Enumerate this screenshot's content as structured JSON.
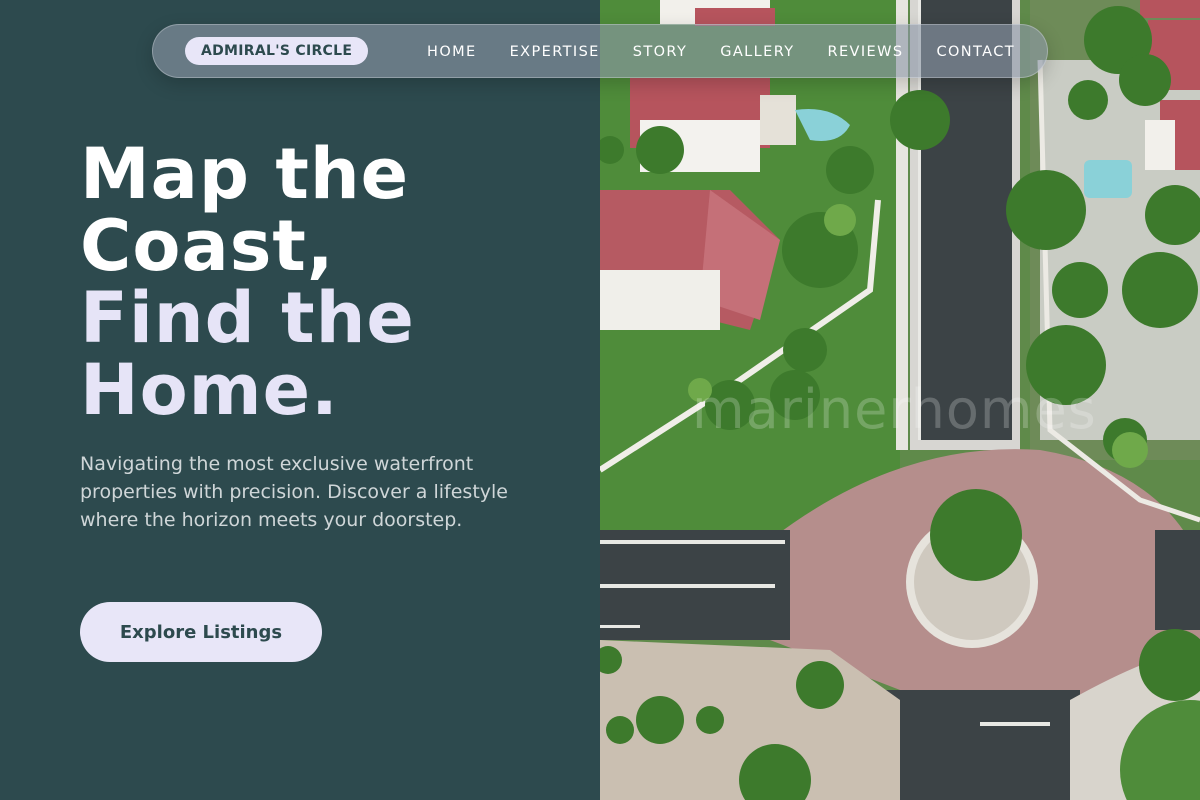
{
  "brand": {
    "name": "ADMIRAL'S CIRCLE"
  },
  "nav": {
    "items": [
      {
        "label": "HOME"
      },
      {
        "label": "EXPERTISE"
      },
      {
        "label": "STORY"
      },
      {
        "label": "GALLERY"
      },
      {
        "label": "REVIEWS"
      },
      {
        "label": "CONTACT"
      }
    ]
  },
  "hero": {
    "title_lines": [
      "Map the",
      "Coast,",
      "Find the",
      "Home."
    ],
    "description": "Navigating the most exclusive waterfront properties with precision. Discover a lifestyle where the horizon meets your doorstep.",
    "cta_label": "Explore Listings"
  },
  "image": {
    "subject": "aerial-neighborhood-photo",
    "watermark": "marinerhomes"
  },
  "colors": {
    "background": "#2d4a4e",
    "accent": "#e6e4f7",
    "button_bg": "#e8e6f8",
    "button_text": "#2d4a4e"
  }
}
